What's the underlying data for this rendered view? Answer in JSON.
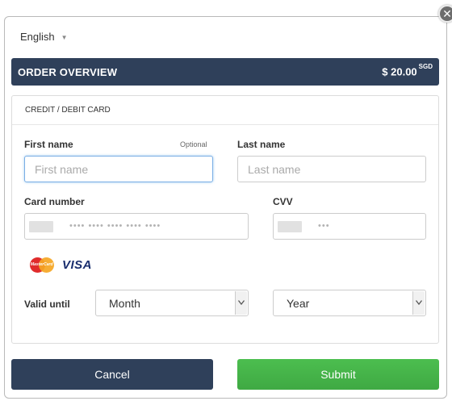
{
  "language": {
    "selected": "English"
  },
  "order": {
    "title": "ORDER OVERVIEW",
    "amount": "$ 20.00",
    "currency": "SGD"
  },
  "payment": {
    "section_title": "CREDIT / DEBIT CARD",
    "first_name": {
      "label": "First name",
      "optional": "Optional",
      "placeholder": "First name",
      "value": ""
    },
    "last_name": {
      "label": "Last name",
      "placeholder": "Last name",
      "value": ""
    },
    "card_number": {
      "label": "Card number",
      "placeholder": "•••• •••• •••• •••• ••••"
    },
    "cvv": {
      "label": "CVV",
      "placeholder": "•••"
    },
    "card_brands": [
      "MasterCard",
      "VISA"
    ],
    "valid_until": {
      "label": "Valid until",
      "month": "Month",
      "year": "Year"
    }
  },
  "actions": {
    "cancel": "Cancel",
    "submit": "Submit"
  },
  "colors": {
    "primary": "#2f405a",
    "submit": "#43b047",
    "focus": "#7aaee5"
  }
}
